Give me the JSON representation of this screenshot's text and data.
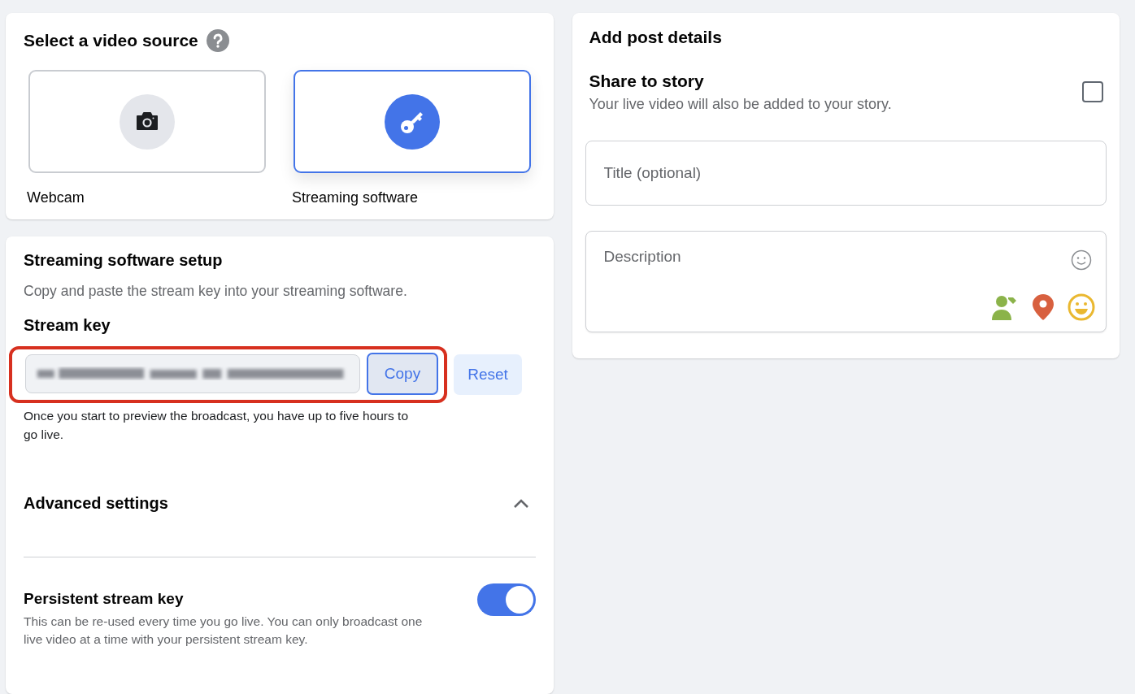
{
  "video_source": {
    "title": "Select a video source",
    "options": [
      {
        "kind": "webcam",
        "label": "Webcam",
        "selected": false
      },
      {
        "kind": "software",
        "label": "Streaming software",
        "selected": true
      }
    ]
  },
  "setup": {
    "title": "Streaming software setup",
    "description": "Copy and paste the stream key into your streaming software.",
    "stream_key": {
      "label": "Stream key",
      "value_blurred": true,
      "highlighted": true,
      "copy_button": "Copy",
      "reset_button": "Reset",
      "note": "Once you start to preview the broadcast, you have up to five hours to go live."
    },
    "advanced": {
      "title": "Advanced settings",
      "expanded": true,
      "settings": [
        {
          "title": "Persistent stream key",
          "description": "This can be re-used every time you go live. You can only broadcast one live video at a time with your persistent stream key.",
          "on": true
        }
      ]
    }
  },
  "post_details": {
    "title": "Add post details",
    "share_to_story": {
      "title": "Share to story",
      "description": "Your live video will also be added to your story.",
      "checked": false
    },
    "title_field": {
      "placeholder": "Title (optional)"
    },
    "description_field": {
      "placeholder": "Description"
    }
  }
}
